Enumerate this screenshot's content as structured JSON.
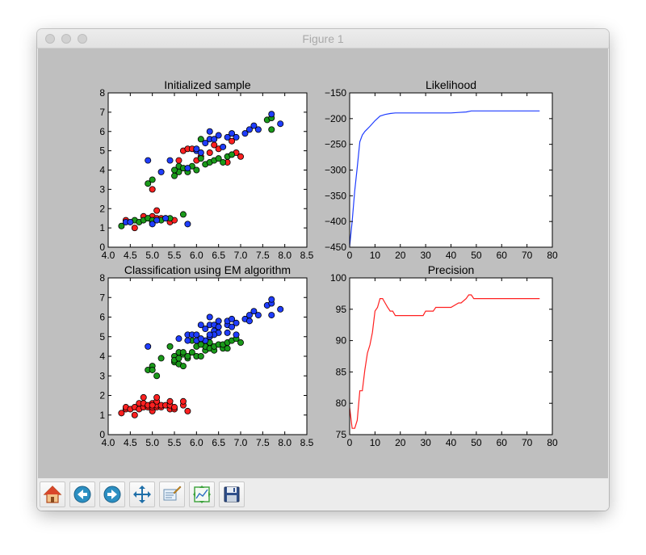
{
  "window": {
    "title": "Figure 1"
  },
  "toolbar": {
    "buttons": [
      {
        "icon": "home-icon"
      },
      {
        "icon": "back-icon"
      },
      {
        "icon": "forward-icon"
      },
      {
        "icon": "pan-icon"
      },
      {
        "icon": "zoom-icon"
      },
      {
        "icon": "configure-subplots-icon"
      },
      {
        "icon": "save-icon"
      }
    ]
  },
  "colors": {
    "red": "#ff2020",
    "green": "#1a9a1a",
    "blue": "#1f3dff",
    "likelihood_line": "#1f3dff",
    "precision_line": "#ff2020"
  },
  "chart_data": [
    {
      "type": "scatter",
      "title": "Initialized sample",
      "xlim": [
        4.0,
        8.5
      ],
      "ylim": [
        0,
        8
      ],
      "xticks": [
        "4.0",
        "4.5",
        "5.0",
        "5.5",
        "6.0",
        "6.5",
        "7.0",
        "7.5",
        "8.0",
        "8.5"
      ],
      "yticks": [
        "0",
        "1",
        "2",
        "3",
        "4",
        "5",
        "6",
        "7",
        "8"
      ],
      "series": [
        {
          "color": "red",
          "points": [
            [
              4.4,
              1.4
            ],
            [
              4.6,
              1.0
            ],
            [
              4.8,
              1.6
            ],
            [
              4.9,
              1.5
            ],
            [
              5.0,
              1.3
            ],
            [
              5.0,
              1.6
            ],
            [
              5.1,
              1.5
            ],
            [
              5.1,
              1.9
            ],
            [
              5.2,
              1.5
            ],
            [
              5.3,
              1.5
            ],
            [
              5.4,
              1.3
            ],
            [
              5.5,
              1.4
            ],
            [
              5.0,
              3.0
            ],
            [
              5.6,
              4.5
            ],
            [
              5.7,
              5.0
            ],
            [
              5.8,
              5.1
            ],
            [
              5.9,
              5.1
            ],
            [
              6.0,
              4.5
            ],
            [
              6.1,
              4.7
            ],
            [
              6.3,
              4.9
            ],
            [
              6.4,
              5.3
            ],
            [
              6.5,
              5.1
            ],
            [
              6.7,
              4.4
            ],
            [
              6.9,
              4.9
            ],
            [
              7.0,
              4.7
            ],
            [
              6.8,
              5.5
            ]
          ]
        },
        {
          "color": "green",
          "points": [
            [
              4.3,
              1.1
            ],
            [
              4.6,
              1.4
            ],
            [
              4.7,
              1.3
            ],
            [
              4.8,
              1.4
            ],
            [
              4.9,
              1.5
            ],
            [
              5.0,
              1.4
            ],
            [
              5.2,
              1.4
            ],
            [
              5.4,
              1.5
            ],
            [
              5.7,
              1.7
            ],
            [
              4.9,
              3.3
            ],
            [
              5.0,
              3.5
            ],
            [
              5.5,
              3.7
            ],
            [
              5.6,
              4.2
            ],
            [
              5.7,
              4.1
            ],
            [
              5.8,
              3.9
            ],
            [
              5.9,
              4.2
            ],
            [
              6.0,
              4.0
            ],
            [
              6.1,
              4.6
            ],
            [
              6.2,
              4.3
            ],
            [
              6.3,
              4.4
            ],
            [
              6.4,
              4.5
            ],
            [
              6.5,
              4.6
            ],
            [
              6.6,
              4.4
            ],
            [
              6.7,
              4.7
            ],
            [
              6.8,
              4.8
            ],
            [
              5.6,
              3.9
            ],
            [
              5.5,
              4.0
            ],
            [
              6.1,
              5.6
            ],
            [
              7.7,
              6.1
            ],
            [
              7.6,
              6.6
            ],
            [
              7.7,
              6.7
            ]
          ]
        },
        {
          "color": "blue",
          "points": [
            [
              4.4,
              1.3
            ],
            [
              4.5,
              1.3
            ],
            [
              5.0,
              1.2
            ],
            [
              5.1,
              1.4
            ],
            [
              5.3,
              1.5
            ],
            [
              5.8,
              1.2
            ],
            [
              4.9,
              4.5
            ],
            [
              5.2,
              3.9
            ],
            [
              5.4,
              4.5
            ],
            [
              5.8,
              4.1
            ],
            [
              6.0,
              5.0
            ],
            [
              6.1,
              4.9
            ],
            [
              6.2,
              5.4
            ],
            [
              6.3,
              5.6
            ],
            [
              6.3,
              6.0
            ],
            [
              6.4,
              5.6
            ],
            [
              6.5,
              5.8
            ],
            [
              6.7,
              5.7
            ],
            [
              6.8,
              5.9
            ],
            [
              6.9,
              5.7
            ],
            [
              7.1,
              5.9
            ],
            [
              7.2,
              6.1
            ],
            [
              7.3,
              6.3
            ],
            [
              7.4,
              6.1
            ],
            [
              7.7,
              6.9
            ],
            [
              7.9,
              6.4
            ],
            [
              6.6,
              5.2
            ],
            [
              6.0,
              5.1
            ]
          ]
        }
      ]
    },
    {
      "type": "line",
      "title": "Likelihood",
      "xlim": [
        0,
        80
      ],
      "ylim": [
        -450,
        -150
      ],
      "xticks": [
        "0",
        "10",
        "20",
        "30",
        "40",
        "50",
        "60",
        "70",
        "80"
      ],
      "yticks": [
        "−450",
        "−400",
        "−350",
        "−300",
        "−250",
        "−200",
        "−150"
      ],
      "series": [
        {
          "color": "likelihood_line",
          "x": [
            0,
            1,
            2,
            3,
            4,
            5,
            6,
            7,
            8,
            10,
            12,
            14,
            16,
            18,
            20,
            25,
            30,
            40,
            43,
            46,
            48,
            50,
            60,
            70,
            75
          ],
          "y": [
            -448,
            -400,
            -340,
            -295,
            -245,
            -232,
            -225,
            -220,
            -215,
            -204,
            -195,
            -192,
            -190,
            -189,
            -189,
            -189,
            -189,
            -189,
            -188,
            -187,
            -185,
            -185,
            -185,
            -185,
            -185
          ]
        }
      ]
    },
    {
      "type": "scatter",
      "title": "Classification using EM algorithm",
      "xlim": [
        4.0,
        8.5
      ],
      "ylim": [
        0,
        8
      ],
      "xticks": [
        "4.0",
        "4.5",
        "5.0",
        "5.5",
        "6.0",
        "6.5",
        "7.0",
        "7.5",
        "8.0",
        "8.5"
      ],
      "yticks": [
        "0",
        "1",
        "2",
        "3",
        "4",
        "5",
        "6",
        "7",
        "8"
      ],
      "series": [
        {
          "color": "red",
          "points": [
            [
              4.3,
              1.1
            ],
            [
              4.4,
              1.3
            ],
            [
              4.4,
              1.4
            ],
            [
              4.5,
              1.3
            ],
            [
              4.6,
              1.0
            ],
            [
              4.6,
              1.4
            ],
            [
              4.7,
              1.3
            ],
            [
              4.7,
              1.6
            ],
            [
              4.8,
              1.4
            ],
            [
              4.8,
              1.6
            ],
            [
              4.8,
              1.9
            ],
            [
              4.9,
              1.4
            ],
            [
              4.9,
              1.5
            ],
            [
              5.0,
              1.2
            ],
            [
              5.0,
              1.4
            ],
            [
              5.0,
              1.6
            ],
            [
              5.1,
              1.4
            ],
            [
              5.1,
              1.5
            ],
            [
              5.1,
              1.7
            ],
            [
              5.1,
              1.9
            ],
            [
              5.2,
              1.4
            ],
            [
              5.2,
              1.5
            ],
            [
              5.3,
              1.5
            ],
            [
              5.4,
              1.3
            ],
            [
              5.4,
              1.5
            ],
            [
              5.4,
              1.7
            ],
            [
              5.5,
              1.3
            ],
            [
              5.5,
              1.4
            ],
            [
              5.7,
              1.5
            ],
            [
              5.7,
              1.7
            ],
            [
              5.8,
              1.2
            ],
            [
              5.0,
              1.5
            ]
          ]
        },
        {
          "color": "green",
          "points": [
            [
              4.9,
              3.3
            ],
            [
              5.0,
              3.5
            ],
            [
              5.0,
              3.3
            ],
            [
              5.1,
              3.0
            ],
            [
              5.5,
              3.7
            ],
            [
              5.5,
              4.0
            ],
            [
              5.5,
              3.8
            ],
            [
              5.6,
              3.6
            ],
            [
              5.6,
              3.9
            ],
            [
              5.6,
              4.2
            ],
            [
              5.7,
              3.5
            ],
            [
              5.7,
              4.1
            ],
            [
              5.7,
              4.2
            ],
            [
              5.8,
              3.9
            ],
            [
              5.8,
              4.0
            ],
            [
              5.9,
              4.2
            ],
            [
              5.9,
              4.8
            ],
            [
              6.0,
              4.0
            ],
            [
              6.0,
              4.5
            ],
            [
              6.1,
              4.0
            ],
            [
              6.1,
              4.7
            ],
            [
              6.2,
              4.3
            ],
            [
              6.2,
              4.5
            ],
            [
              6.3,
              4.4
            ],
            [
              6.3,
              4.7
            ],
            [
              6.4,
              4.3
            ],
            [
              6.4,
              4.5
            ],
            [
              6.5,
              4.6
            ],
            [
              6.6,
              4.4
            ],
            [
              6.6,
              4.6
            ],
            [
              6.7,
              4.4
            ],
            [
              6.7,
              4.7
            ],
            [
              6.8,
              4.8
            ],
            [
              6.9,
              4.9
            ],
            [
              7.0,
              4.7
            ],
            [
              5.2,
              3.9
            ],
            [
              5.4,
              4.5
            ],
            [
              6.1,
              4.6
            ]
          ]
        },
        {
          "color": "blue",
          "points": [
            [
              4.9,
              4.5
            ],
            [
              5.6,
              4.9
            ],
            [
              5.8,
              5.1
            ],
            [
              5.9,
              5.1
            ],
            [
              6.0,
              4.8
            ],
            [
              6.0,
              5.1
            ],
            [
              6.1,
              5.6
            ],
            [
              6.2,
              4.8
            ],
            [
              6.2,
              5.4
            ],
            [
              6.3,
              5.0
            ],
            [
              6.3,
              5.6
            ],
            [
              6.3,
              6.0
            ],
            [
              6.4,
              5.3
            ],
            [
              6.4,
              5.6
            ],
            [
              6.5,
              5.2
            ],
            [
              6.5,
              5.5
            ],
            [
              6.5,
              5.8
            ],
            [
              6.7,
              5.2
            ],
            [
              6.7,
              5.6
            ],
            [
              6.7,
              5.8
            ],
            [
              6.8,
              5.5
            ],
            [
              6.8,
              5.9
            ],
            [
              6.9,
              5.1
            ],
            [
              6.9,
              5.7
            ],
            [
              7.1,
              5.9
            ],
            [
              7.2,
              5.8
            ],
            [
              7.2,
              6.1
            ],
            [
              7.3,
              6.3
            ],
            [
              7.4,
              6.1
            ],
            [
              7.6,
              6.6
            ],
            [
              7.7,
              6.1
            ],
            [
              7.7,
              6.7
            ],
            [
              7.7,
              6.9
            ],
            [
              7.9,
              6.4
            ],
            [
              6.1,
              4.9
            ],
            [
              6.4,
              5.1
            ],
            [
              5.8,
              4.8
            ],
            [
              6.3,
              5.1
            ]
          ]
        }
      ]
    },
    {
      "type": "line",
      "title": "Precision",
      "xlim": [
        0,
        80
      ],
      "ylim": [
        75,
        100
      ],
      "xticks": [
        "0",
        "10",
        "20",
        "30",
        "40",
        "50",
        "60",
        "70",
        "80"
      ],
      "yticks": [
        "75",
        "80",
        "85",
        "90",
        "95",
        "100"
      ],
      "series": [
        {
          "color": "precision_line",
          "x": [
            0,
            1,
            2,
            3,
            4,
            5,
            6,
            7,
            8,
            9,
            10,
            11,
            12,
            13,
            14,
            15,
            16,
            17,
            18,
            19,
            20,
            21,
            25,
            29,
            30,
            33,
            34,
            35,
            40,
            43,
            44,
            46,
            47,
            48,
            49,
            50,
            60,
            70,
            75
          ],
          "y": [
            79.3,
            76.0,
            76.0,
            77.3,
            82.0,
            82.0,
            85.3,
            88.0,
            89.3,
            91.3,
            94.7,
            95.3,
            96.7,
            96.7,
            96.0,
            95.3,
            94.7,
            94.7,
            94.0,
            94.0,
            94.0,
            94.0,
            94.0,
            94.0,
            94.7,
            94.7,
            95.3,
            95.3,
            95.3,
            96.0,
            96.0,
            96.7,
            97.3,
            97.3,
            96.7,
            96.7,
            96.7,
            96.7,
            96.7
          ]
        }
      ]
    }
  ]
}
